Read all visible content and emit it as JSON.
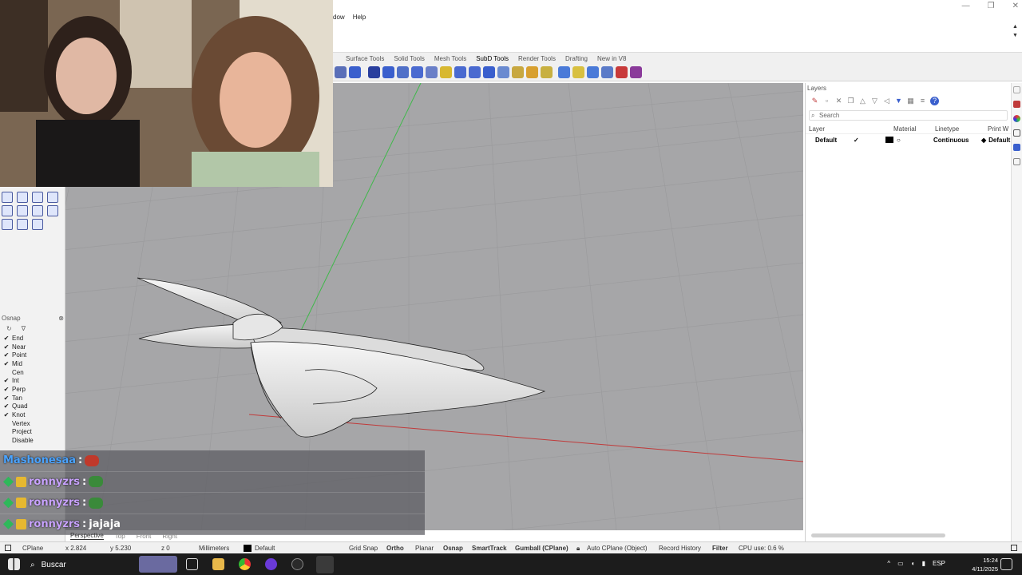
{
  "window": {
    "controls": [
      "—",
      "❐",
      "✕"
    ]
  },
  "menubar": {
    "items": [
      "dow",
      "Help"
    ]
  },
  "tabs": [
    "Surface Tools",
    "Solid Tools",
    "Mesh Tools",
    "SubD Tools",
    "Render Tools",
    "Drafting",
    "New in V8"
  ],
  "active_tab": "SubD Tools",
  "osnap": {
    "title": "Osnap",
    "items": [
      {
        "label": "End",
        "checked": "✔"
      },
      {
        "label": "Near",
        "checked": "✔"
      },
      {
        "label": "Point",
        "checked": "✔"
      },
      {
        "label": "Mid",
        "checked": "✔"
      },
      {
        "label": "Cen",
        "checked": ""
      },
      {
        "label": "Int",
        "checked": "✔"
      },
      {
        "label": "Perp",
        "checked": "✔"
      },
      {
        "label": "Tan",
        "checked": "✔"
      },
      {
        "label": "Quad",
        "checked": "✔"
      },
      {
        "label": "Knot",
        "checked": "✔"
      },
      {
        "label": "Vertex",
        "checked": ""
      },
      {
        "label": "Project",
        "checked": ""
      },
      {
        "label": "Disable",
        "checked": ""
      }
    ]
  },
  "layers": {
    "title": "Layers",
    "search_placeholder": "Search",
    "columns": [
      "Layer",
      "Material",
      "Linetype",
      "Print W"
    ],
    "row": {
      "name": "Default",
      "current": "✓",
      "linetype": "Continuous",
      "print_width": "Default"
    }
  },
  "chat": [
    {
      "user": "Mashonesaa",
      "sep": ":",
      "msg": "",
      "emote_color": "#c0392b"
    },
    {
      "user": "ronnyzrs",
      "sep": ":",
      "msg": "",
      "emote_color": "#3a8a3a"
    },
    {
      "user": "ronnyzrs",
      "sep": ":",
      "msg": "",
      "emote_color": "#3a8a3a"
    },
    {
      "user": "ronnyzrs",
      "sep": ":",
      "msg": "jajaja",
      "emote_color": ""
    }
  ],
  "viewport_tabs": [
    "Perspective",
    "Top",
    "Front",
    "Right"
  ],
  "statusbar": {
    "cplane": "CPlane",
    "x": "x 2.824",
    "y": "y 5.230",
    "z": "z 0",
    "units": "Millimeters",
    "layer": "Default",
    "grid_snap": "Grid Snap",
    "ortho": "Ortho",
    "planar": "Planar",
    "osnap": "Osnap",
    "smarttrack": "SmartTrack",
    "gumball": "Gumball (CPlane)",
    "auto_cplane": "Auto CPlane (Object)",
    "record_history": "Record History",
    "filter": "Filter",
    "cpu": "CPU use: 0.6 %"
  },
  "taskbar": {
    "search": "Buscar",
    "lang": "ESP",
    "time": "15:24",
    "date": "4/11/2025"
  },
  "colors": {
    "viewport_bg": "#a6a6a8",
    "chat_user": "#c9a3ff",
    "chat_first_user": "#4aa3ff",
    "accent_blue": "#3a5fcd"
  }
}
